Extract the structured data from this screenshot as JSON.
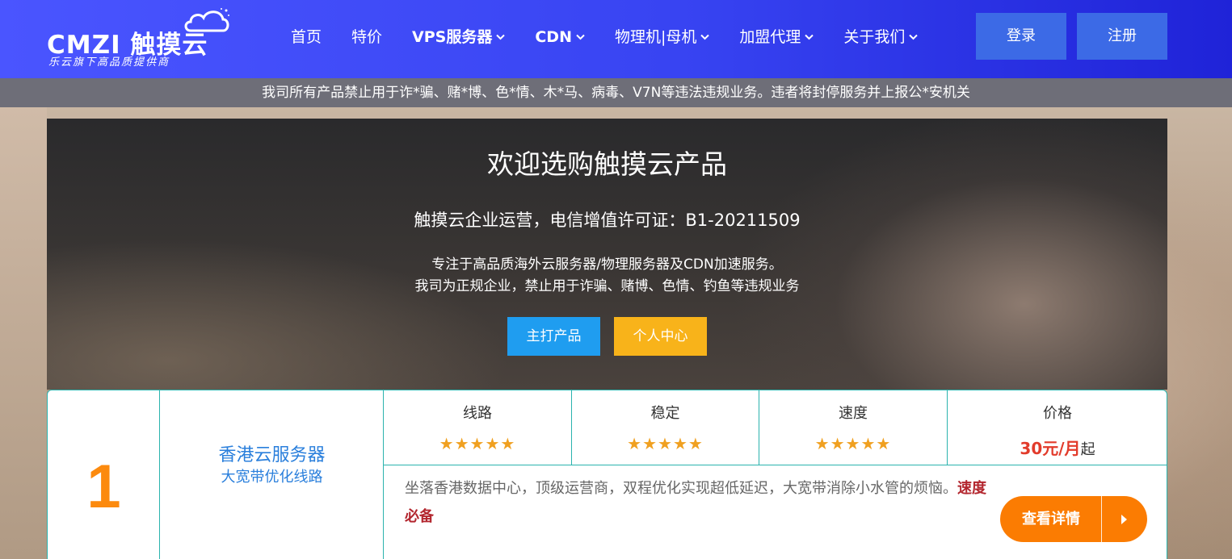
{
  "logo": {
    "main": "CMZI 触摸云",
    "sub": "乐云旗下高品质提供商"
  },
  "nav": {
    "items": [
      {
        "label": "首页",
        "dropdown": false
      },
      {
        "label": "特价",
        "dropdown": false
      },
      {
        "label": "VPS服务器",
        "dropdown": true
      },
      {
        "label": "CDN",
        "dropdown": true
      },
      {
        "label": "物理机|母机",
        "dropdown": true
      },
      {
        "label": "加盟代理",
        "dropdown": true
      },
      {
        "label": "关于我们",
        "dropdown": true
      }
    ],
    "login_label": "登录",
    "register_label": "注册"
  },
  "notice": {
    "text": "我司所有产品禁止用于诈*骗、赌*博、色*情、木*马、病毒、V7N等违法违规业务。违者将封停服务并上报公*安机关"
  },
  "banner": {
    "title": "欢迎选购触摸云产品",
    "license": "触摸云企业运营，电信增值许可证：B1-20211509",
    "desc_line1": "专注于高品质海外云服务器/物理服务器及CDN加速服务。",
    "desc_line2": "我司为正规企业，禁止用于诈骗、赌博、色情、钓鱼等违规业务",
    "btn_main": "主打产品",
    "btn_user": "个人中心"
  },
  "product": {
    "rank": "1",
    "name": "香港云服务器",
    "subtitle": "大宽带优化线路",
    "metrics": [
      {
        "label": "线路",
        "stars": 5
      },
      {
        "label": "稳定",
        "stars": 5
      },
      {
        "label": "速度",
        "stars": 5
      }
    ],
    "price_label": "价格",
    "price": "30元/月",
    "price_suffix": "起",
    "description": "坐落香港数据中心，顶级运营商，双程优化实现超低延迟，大宽带消除小水管的烦恼。",
    "description_strong": "速度必备",
    "detail_button": "查看详情"
  },
  "colors": {
    "header_start": "#4a55ff",
    "header_end": "#1f23d8",
    "button_blue": "#3c6ae6",
    "accent_orange": "#fb7c02",
    "rank_orange": "#fc8a0e",
    "price_red": "#e23b2b",
    "card_border": "#2bb3ae",
    "star_gold": "#f0a020"
  },
  "icons": {
    "dropdown": "chevron-down-icon",
    "logo": "cloud-icon",
    "star": "star-icon",
    "detail_arrow": "play-arrow-icon"
  }
}
